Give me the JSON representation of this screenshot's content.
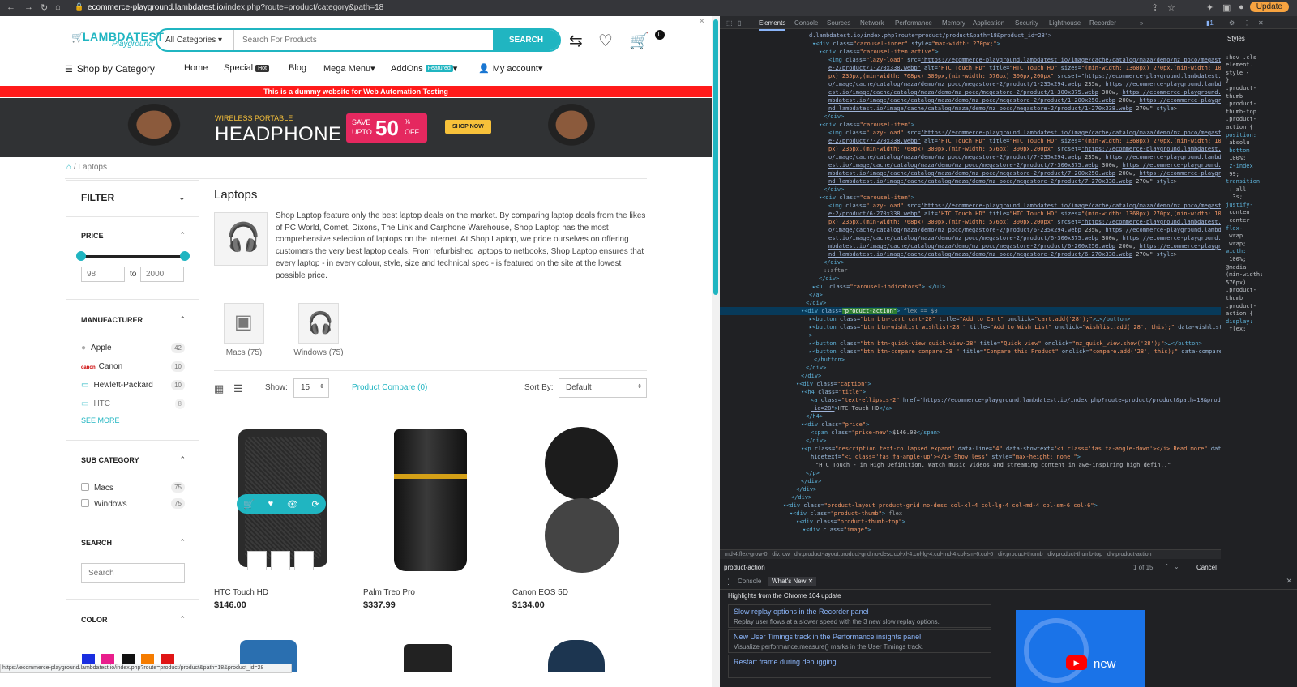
{
  "browser": {
    "url_domain": "ecommerce-playground.lambdatest.io",
    "url_path": "/index.php?route=product/category&path=18",
    "update_label": "Update"
  },
  "header": {
    "logo_main": "LAMBDATEST",
    "logo_sub": "Playground",
    "search_category": "All Categories",
    "search_placeholder": "Search For Products",
    "search_button": "SEARCH",
    "cart_count": "0"
  },
  "menu": {
    "shop_by_category": "Shop by Category",
    "items": [
      "Home",
      "Special",
      "Blog",
      "Mega Menu",
      "AddOns",
      "My account"
    ],
    "special_tag": "Hot",
    "addons_tag": "Featured"
  },
  "warning_bar": "This is a dummy website for Web Automation Testing",
  "banner": {
    "line1": "WIRELESS PORTABLE",
    "line2": "HEADPHONE",
    "save": "SAVE",
    "upto": "UPTO",
    "percent": "50",
    "pct_sign": "%",
    "off": "OFF",
    "cta": "SHOP NOW"
  },
  "breadcrumb": {
    "current": "Laptops",
    "separator": "/"
  },
  "filter": {
    "title": "FILTER",
    "price": {
      "label": "PRICE",
      "min": "98",
      "max": "2000",
      "to": "to",
      "range_low_fraction": 0.0,
      "range_high_fraction": 1.0
    },
    "manufacturer": {
      "label": "MANUFACTURER",
      "items": [
        {
          "name": "Apple",
          "count": "42"
        },
        {
          "name": "Canon",
          "count": "10"
        },
        {
          "name": "Hewlett-Packard",
          "count": "10"
        },
        {
          "name": "HTC",
          "count": "8"
        }
      ],
      "see_more": "SEE MORE"
    },
    "sub_category": {
      "label": "SUB CATEGORY",
      "items": [
        {
          "name": "Macs",
          "count": "75"
        },
        {
          "name": "Windows",
          "count": "75"
        }
      ]
    },
    "search": {
      "label": "SEARCH",
      "placeholder": "Search"
    },
    "color": {
      "label": "COLOR",
      "swatches": [
        "#1a2ee0",
        "#e91e8c",
        "#111111",
        "#f57c00",
        "#e01515"
      ]
    }
  },
  "category": {
    "title": "Laptops",
    "description": "Shop Laptop feature only the best laptop deals on the market. By comparing laptop deals from the likes of PC World, Comet, Dixons, The Link and Carphone Warehouse, Shop Laptop has the most comprehensive selection of laptops on the internet. At Shop Laptop, we pride ourselves on offering customers the very best laptop deals. From refurbished laptops to netbooks, Shop Laptop ensures that every laptop - in every colour, style, size and technical spec - is featured on the site at the lowest possible price.",
    "subcategories": [
      "Macs (75)",
      "Windows (75)"
    ]
  },
  "toolbar": {
    "show_label": "Show:",
    "show_value": "15",
    "compare": "Product Compare (0)",
    "sort_label": "Sort By:",
    "sort_value": "Default"
  },
  "products": [
    {
      "name": "HTC Touch HD",
      "price": "$146.00"
    },
    {
      "name": "Palm Treo Pro",
      "price": "$337.99"
    },
    {
      "name": "Canon EOS 5D",
      "price": "$134.00"
    }
  ],
  "status_url": "https://ecommerce-playground.lambdatest.io/index.php?route=product/product&path=18&product_id=28",
  "devtools": {
    "tabs": [
      "Elements",
      "Console",
      "Sources",
      "Network",
      "Performance",
      "Memory",
      "Application",
      "Security",
      "Lighthouse",
      "Recorder"
    ],
    "styles_tab": "Styles",
    "styles_lines": [
      ":hov .cls",
      "element.",
      "style {",
      "}",
      ".product-",
      "thumb",
      ".product-",
      "thumb-top",
      ".product-",
      "action {",
      "position:",
      " absolu",
      " bottom",
      " 100%;",
      " z-index",
      " 99;",
      "transition",
      " : all",
      " .3s;",
      "justify-",
      " conten",
      " center",
      "flex-",
      " wrap",
      " wrap;",
      "width:",
      " 100%;",
      "@media",
      "(min-width:",
      "576px)",
      ".product-",
      "thumb",
      ".product-",
      "action {",
      "display:",
      " flex;"
    ],
    "breadcrumb": [
      "md-4.flex-grow-0",
      "div.row",
      "div.product-layout.product-grid.no-desc.col-xl-4.col-lg-4.col-md-4.col-sm-6.col-6",
      "div.product-thumb",
      "div.product-thumb-top",
      "div.product-action"
    ],
    "find_value": "product-action",
    "find_count": "1 of 15",
    "find_cancel": "Cancel",
    "drawer_tabs": [
      "Console",
      "What's New"
    ],
    "drawer_heading": "Highlights from the Chrome 104 update",
    "news": [
      {
        "title": "Slow replay options in the Recorder panel",
        "desc": "Replay user flows at a slower speed with the 3 new slow replay options."
      },
      {
        "title": "New User Timings track in the Performance insights panel",
        "desc": "Visualize performance.measure() marks in the User Timings track."
      },
      {
        "title": "Restart frame during debugging",
        "desc": ""
      }
    ],
    "video_label": "new"
  }
}
